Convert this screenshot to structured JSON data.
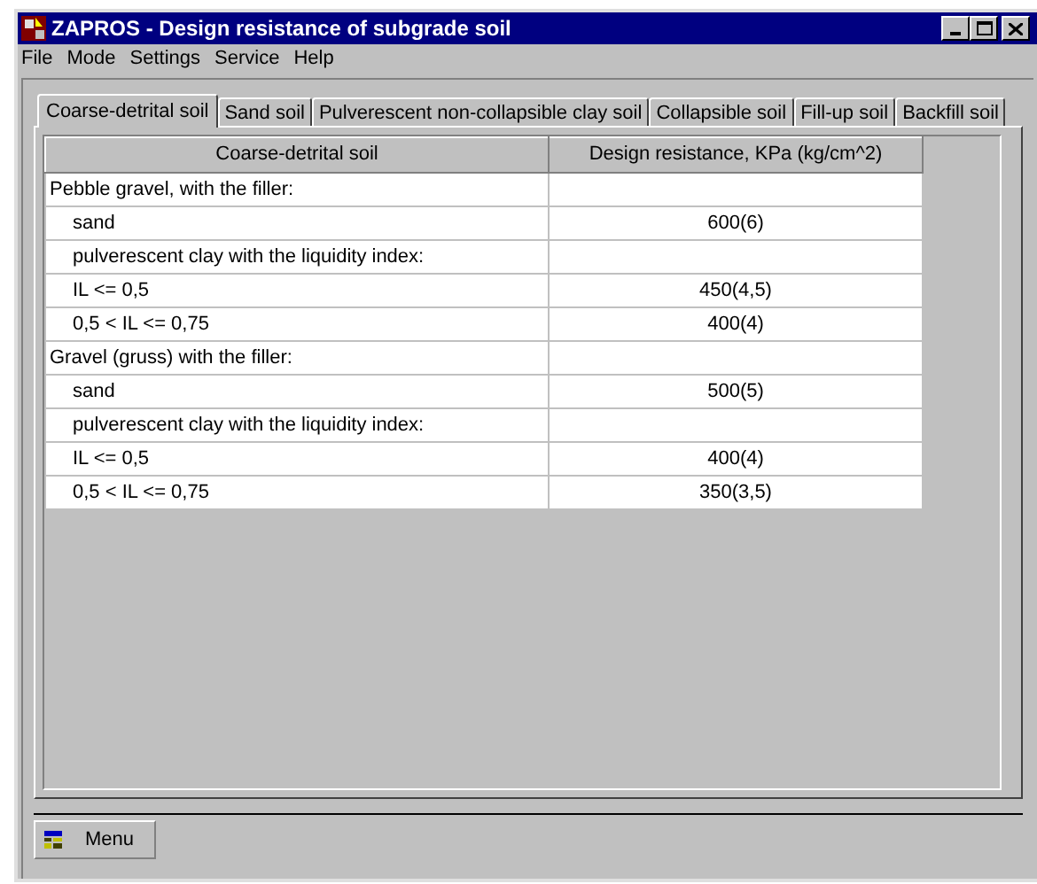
{
  "window": {
    "title": "ZAPROS - Design resistance of subgrade soil"
  },
  "menu": [
    "File",
    "Mode",
    "Settings",
    "Service",
    "Help"
  ],
  "tabs": [
    {
      "label": "Coarse-detrital soil",
      "selected": true
    },
    {
      "label": "Sand soil",
      "selected": false
    },
    {
      "label": "Pulverescent non-collapsible clay soil",
      "selected": false
    },
    {
      "label": "Collapsible soil",
      "selected": false
    },
    {
      "label": "Fill-up soil",
      "selected": false
    },
    {
      "label": "Backfill soil",
      "selected": false
    }
  ],
  "table": {
    "columns": [
      "Coarse-detrital soil",
      "Design resistance, KPa (kg/cm^2)"
    ],
    "rows": [
      {
        "soil": "Pebble gravel, with the filler:",
        "indented": false
      },
      {
        "soil": "sand",
        "indented": true,
        "resistance": "600(6)"
      },
      {
        "soil": "pulverescent clay with the liquidity index:",
        "indented": true
      },
      {
        "soil": "IL <= 0,5",
        "indented": true,
        "resistance": "450(4,5)"
      },
      {
        "soil": "0,5 < IL <= 0,75",
        "indented": true,
        "resistance": "400(4)"
      },
      {
        "soil": "Gravel (gruss) with the filler:",
        "indented": false
      },
      {
        "soil": "sand",
        "indented": true,
        "resistance": "500(5)"
      },
      {
        "soil": "pulverescent clay with the liquidity index:",
        "indented": true
      },
      {
        "soil": "IL <= 0,5",
        "indented": true,
        "resistance": "400(4)"
      },
      {
        "soil": "0,5 < IL <= 0,75",
        "indented": true,
        "resistance": "350(3,5)"
      }
    ]
  },
  "menu_button": {
    "label": "Menu"
  }
}
